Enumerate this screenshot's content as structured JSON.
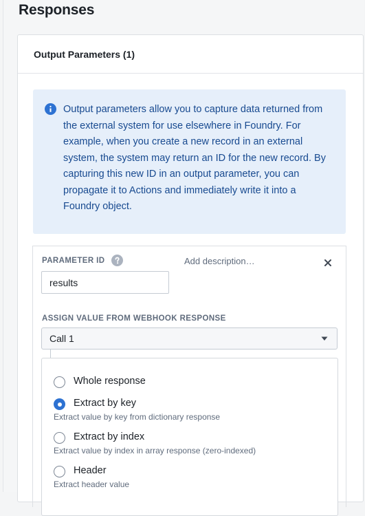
{
  "page": {
    "title": "Responses"
  },
  "card": {
    "title": "Output Parameters (1)"
  },
  "callout": {
    "icon": "info-icon",
    "text": "Output parameters allow you to capture data returned from the external system for use elsewhere in Foundry. For example, when you create a new record in an external system, the system may return an ID for the new record. By capturing this new ID in an output parameter, you can propagate it to Actions and immediately write it into a Foundry object.",
    "color": "#184a90",
    "background": "#e6effa"
  },
  "parameter": {
    "id_label": "PARAMETER ID",
    "add_description": "Add description…",
    "id_value": "results",
    "assign_label": "ASSIGN VALUE FROM WEBHOOK RESPONSE",
    "selected_call": "Call 1",
    "options": [
      {
        "label": "Whole response",
        "description": "",
        "checked": false
      },
      {
        "label": "Extract by key",
        "description": "Extract value by key from dictionary response",
        "checked": true
      },
      {
        "label": "Extract by index",
        "description": "Extract value by index in array response (zero-indexed)",
        "checked": false
      },
      {
        "label": "Header",
        "description": "Extract header value",
        "checked": false
      }
    ]
  },
  "colors": {
    "accent": "#2d72d2",
    "muted_text": "#5f6b7c"
  }
}
